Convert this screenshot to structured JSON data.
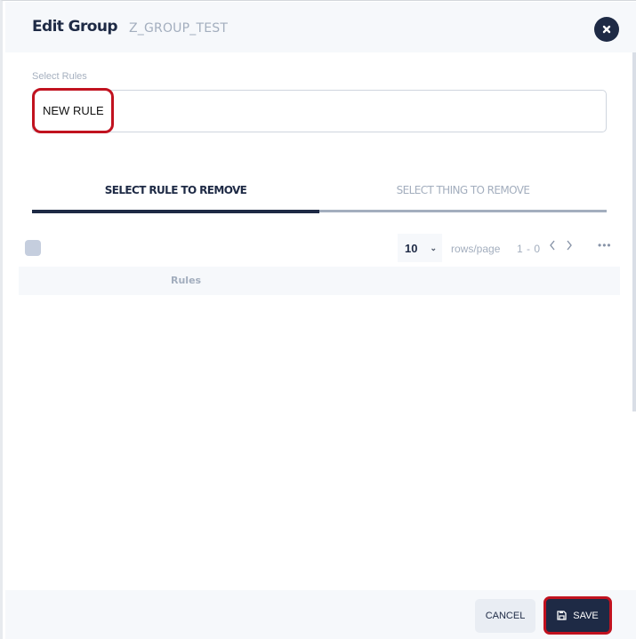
{
  "dialog": {
    "title": "Edit Group",
    "group_name": "Z_GROUP_TEST"
  },
  "rules_field": {
    "label": "Select Rules",
    "selected_value": "NEW RULE"
  },
  "tabs": [
    {
      "label": "SELECT RULE TO REMOVE",
      "active": true
    },
    {
      "label": "SELECT THING TO REMOVE",
      "active": false
    }
  ],
  "table": {
    "rows_per_page": "10",
    "rows_label": "rows/page",
    "range": "1 - 0",
    "more_label": "•••",
    "columns": [
      "Rules"
    ],
    "rows": []
  },
  "footer": {
    "cancel_label": "CANCEL",
    "save_label": "SAVE"
  },
  "colors": {
    "primary": "#1e2a45",
    "highlight": "#c1121f",
    "muted": "#a3aebe"
  }
}
